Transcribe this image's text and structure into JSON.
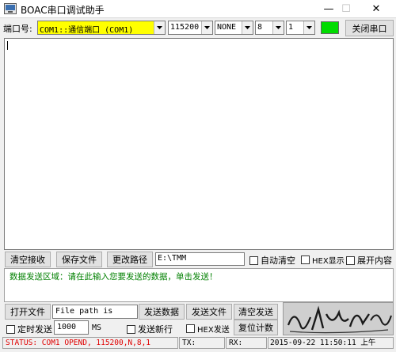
{
  "titlebar": {
    "title": "BOAC串口调试助手",
    "minimize": "—",
    "maximize": "☐",
    "close": "✕"
  },
  "config": {
    "port_label": "端口号:",
    "port_value": "COM1::通信端口 (COM1)",
    "baud_value": "115200",
    "parity_value": "NONE",
    "databits_value": "8",
    "stopbits_value": "1",
    "indicator_color": "#00dc00",
    "close_port_label": "关闭串口"
  },
  "receive": {
    "clear_label": "清空接收",
    "save_file_label": "保存文件",
    "change_path_label": "更改路径",
    "path_value": "E:\\TMM",
    "auto_clear_label": "自动清空",
    "hex_display_label": "HEX显示",
    "expand_label": "展开内容"
  },
  "send": {
    "area_text": "数据发送区域：请在此输入您要发送的数据，单击发送！",
    "open_file_label": "打开文件",
    "file_path_value": "File path is",
    "send_data_label": "发送数据",
    "send_file_label": "发送文件",
    "clear_send_label": "清空发送",
    "timed_send_label": "定时发送",
    "interval_value": "1000",
    "ms_label": "MS",
    "newline_label": "发送新行",
    "hex_send_label": "HEX发送",
    "reset_count_label": "复位计数"
  },
  "status": {
    "status_text": "STATUS: COM1 OPEND, 115200,N,8,1",
    "tx_label": "TX:",
    "rx_label": "RX:",
    "datetime": "2015-09-22  11:50:11 上午"
  }
}
